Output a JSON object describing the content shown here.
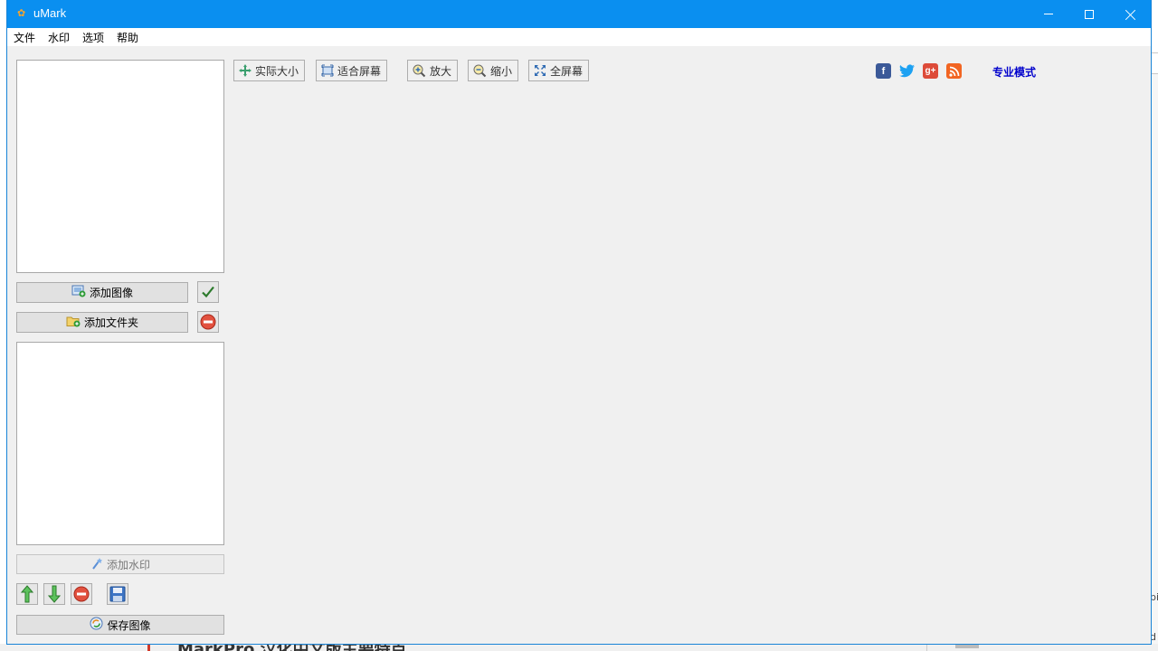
{
  "window": {
    "title": "uMark"
  },
  "menu": [
    "文件",
    "水印",
    "选项",
    "帮助"
  ],
  "left_panel": {
    "add_image": "添加图像",
    "add_folder": "添加文件夹",
    "add_watermark": "添加水印",
    "save_image": "保存图像"
  },
  "toolbar": {
    "actual_size": "实际大小",
    "fit_screen": "适合屏幕",
    "zoom_in": "放大",
    "zoom_out": "缩小",
    "fullscreen": "全屏幕"
  },
  "social": {
    "facebook": "f",
    "googleplus": "g+"
  },
  "pro_mode": "专业模式",
  "background": {
    "headline": "MarkPro 汉化中文版主要特点",
    "side_text_1": "pi",
    "side_text_2": "d"
  },
  "colors": {
    "titlebar": "#0a8ff0",
    "link": "#0000cc",
    "facebook": "#3b5998",
    "twitter": "#1da1f2",
    "googleplus": "#dd4b39",
    "rss": "#f26522"
  }
}
